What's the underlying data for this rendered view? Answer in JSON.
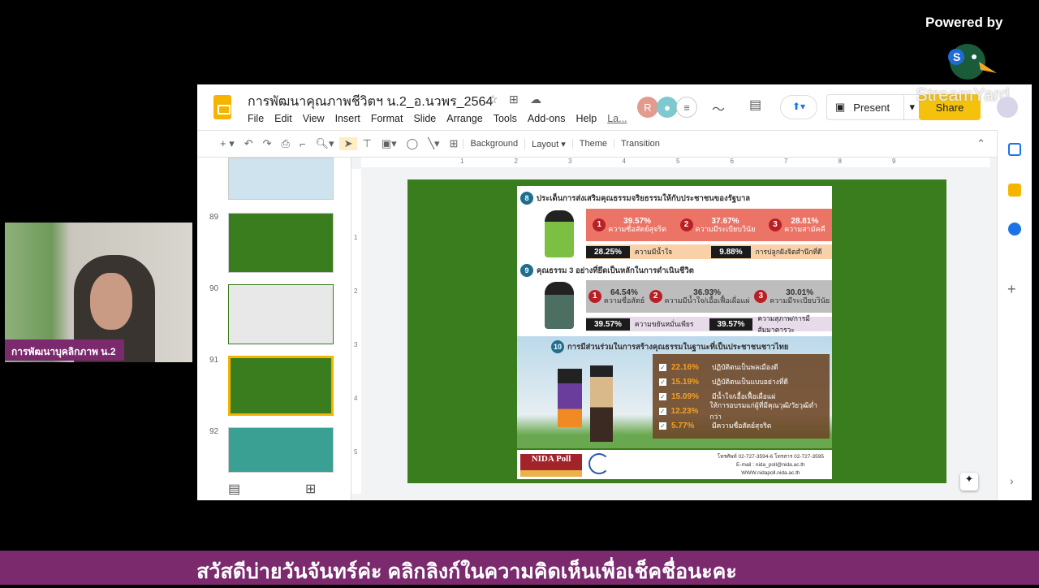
{
  "stream": {
    "powered_by": "Powered by",
    "watermark": "StreamYard",
    "webcam_label": "การพัฒนาบุคลิกภาพ น.2",
    "banner_text": "สวัสดีบ่ายวันจันทร์ค่ะ คลิกลิงก์ในความคิดเห็นเพื่อเช็คชื่อนะคะ"
  },
  "app": {
    "title": "การพัฒนาคุณภาพชีวิตฯ น.2_อ.นวพร_2564",
    "menus": [
      "File",
      "Edit",
      "View",
      "Insert",
      "Format",
      "Slide",
      "Arrange",
      "Tools",
      "Add-ons",
      "Help",
      "La..."
    ],
    "avatar_initial": "R",
    "present_label": "Present",
    "share_label": "Share",
    "toolbar": {
      "background": "Background",
      "layout": "Layout",
      "theme": "Theme",
      "transition": "Transition"
    },
    "ruler_marks": [
      "1",
      "2",
      "3",
      "4",
      "5",
      "6",
      "7",
      "8",
      "9"
    ],
    "vruler_marks": [
      "1",
      "2",
      "3",
      "4",
      "5"
    ],
    "slides": [
      {
        "num": "89"
      },
      {
        "num": "90"
      },
      {
        "num": "91",
        "selected": true
      },
      {
        "num": "92"
      }
    ],
    "colors": {
      "accent": "#f4b400",
      "slide_bg": "#3a7d1e",
      "selected": "#f4b400"
    }
  },
  "slide": {
    "s8": {
      "num": "8",
      "title": "ประเด็นการส่งเสริมคุณธรรมจริยธรรมให้กับประชาชนของรัฐบาล",
      "top": [
        {
          "rank": "1",
          "pct": "39.57%",
          "label": "ความซื่อสัตย์สุจริต"
        },
        {
          "rank": "2",
          "pct": "37.67%",
          "label": "ความมีระเบียบวินัย"
        },
        {
          "rank": "3",
          "pct": "28.81%",
          "label": "ความสามัคคี"
        }
      ],
      "extra": [
        {
          "pct": "28.25%",
          "label": "ความมีน้ำใจ"
        },
        {
          "pct": "9.88%",
          "label": "การปลูกฝังจิตสำนึกที่ดี"
        }
      ]
    },
    "s9": {
      "num": "9",
      "title": "คุณธรรม 3 อย่างที่ยึดเป็นหลักในการดำเนินชีวิต",
      "top": [
        {
          "rank": "1",
          "pct": "64.54%",
          "label": "ความซื่อสัตย์"
        },
        {
          "rank": "2",
          "pct": "36.93%",
          "label": "ความมีน้ำใจ/เอื้อเฟื้อเผื่อแผ่"
        },
        {
          "rank": "3",
          "pct": "30.01%",
          "label": "ความมีระเบียบวินัย"
        }
      ],
      "extra": [
        {
          "pct": "39.57%",
          "label": "ความขยันหมั่นเพียร"
        },
        {
          "pct": "39.57%",
          "label": "ความสุภาพ/การมีสัมมาคารวะ"
        }
      ]
    },
    "s10": {
      "num": "10",
      "title": "การมีส่วนร่วมในการสร้างคุณธรรมในฐานะที่เป็นประชาชนชาวไทย",
      "items": [
        {
          "pct": "22.16%",
          "label": "ปฏิบัติตนเป็นพลเมืองดี"
        },
        {
          "pct": "15.19%",
          "label": "ปฏิบัติตนเป็นแบบอย่างที่ดี"
        },
        {
          "pct": "15.09%",
          "label": "มีน้ำใจ/เอื้อเฟื้อเผื่อแผ่"
        },
        {
          "pct": "12.23%",
          "label": "ให้การอบรมแก่ผู้ที่มีคุณวุฒิ/วัยวุฒิต่ำกว่า"
        },
        {
          "pct": "5.77%",
          "label": "มีความซื่อสัตย์สุจริต"
        }
      ]
    },
    "footer": {
      "logo": "NIDA Poll",
      "phone": "โทรศัพท์ 02-727-3594-6 โทรสาร 02-727-3595",
      "email": "E-mail : nida_poll@nida.ac.th",
      "web": "WWW.nidapoll.nida.ac.th"
    }
  }
}
